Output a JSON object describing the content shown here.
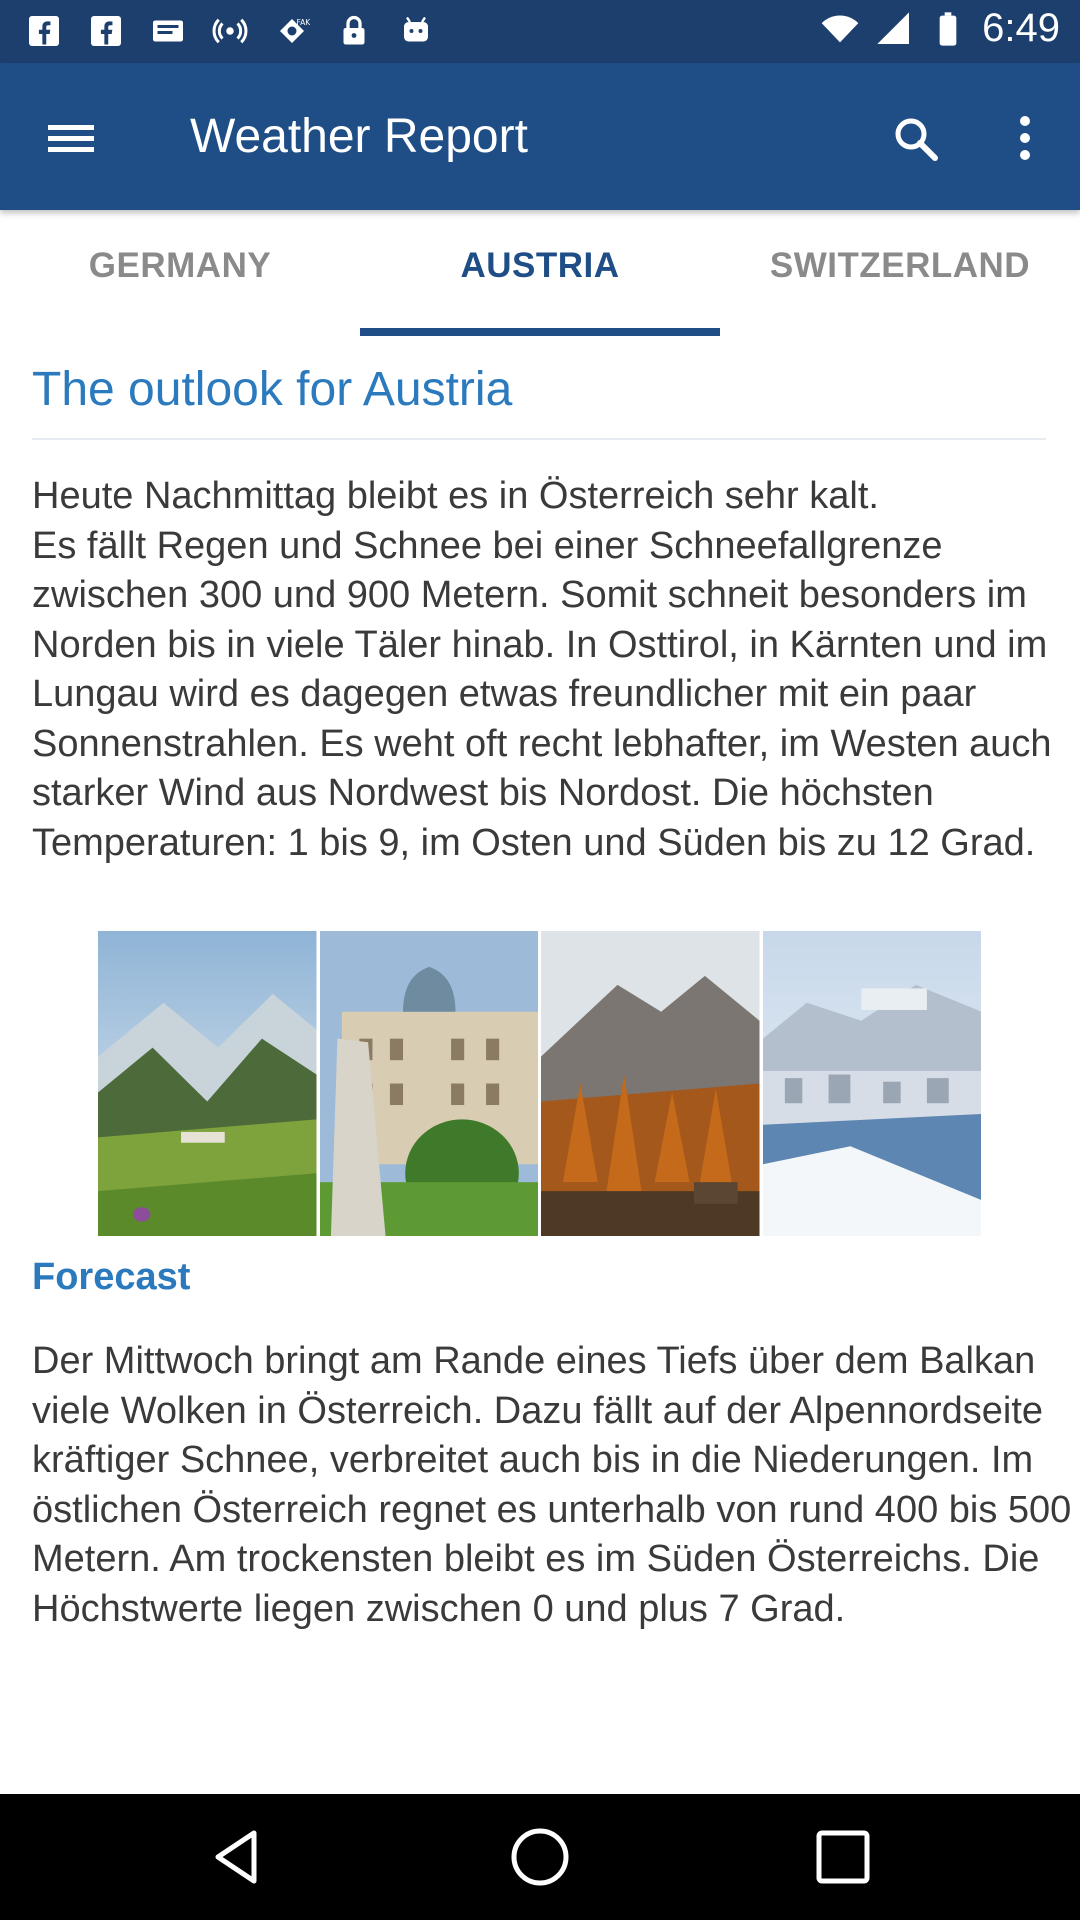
{
  "status_bar": {
    "time": "6:49",
    "left_icons": [
      "facebook-icon",
      "facebook-icon",
      "message-icon",
      "hotspot-icon",
      "fake-gps-icon",
      "lock-icon",
      "android-icon"
    ],
    "right_icons": [
      "wifi-icon",
      "signal-icon",
      "battery-icon"
    ]
  },
  "app_bar": {
    "title": "Weather Report",
    "menu_icon": "hamburger-menu-icon",
    "search_icon": "search-icon",
    "more_icon": "more-vertical-icon",
    "color": "#1f4d86"
  },
  "tabs": [
    {
      "label": "GERMANY",
      "selected": false
    },
    {
      "label": "AUSTRIA",
      "selected": true
    },
    {
      "label": "SWITZERLAND",
      "selected": false
    }
  ],
  "content": {
    "outlook_title": "The outlook for Austria",
    "outlook_text": "Heute Nachmittag bleibt es in Österreich sehr kalt.\nEs fällt Regen und Schnee bei einer Schneefallgrenze zwischen 300 und 900 Metern. Somit schneit besonders im Norden bis in viele Täler hinab. In Osttirol, in Kärnten und im Lungau wird es dagegen etwas freundlicher mit ein paar Sonnenstrahlen. Es weht oft recht lebhafter, im Westen auch starker Wind aus Nordwest bis Nordost. Die höchsten Temperaturen: 1 bis 9, im Osten und Süden bis zu 12 Grad.",
    "forecast_heading": "Forecast",
    "forecast_text": "Der Mittwoch bringt am Rande eines Tiefs über dem Balkan viele Wolken in Österreich. Dazu fällt auf der Alpennordseite kräftiger Schnee, verbreitet auch bis in die Niederungen. Im östlichen Österreich regnet es unterhalb von rund 400 bis 500 Metern. Am trockensten bleibt es im Süden Österreichs. Die Höchstwerte liegen zwischen 0 und plus 7 Grad.",
    "accent_color": "#2a7abd"
  },
  "nav_bar": {
    "back_icon": "back-icon",
    "home_icon": "home-icon",
    "recents_icon": "recents-icon"
  }
}
